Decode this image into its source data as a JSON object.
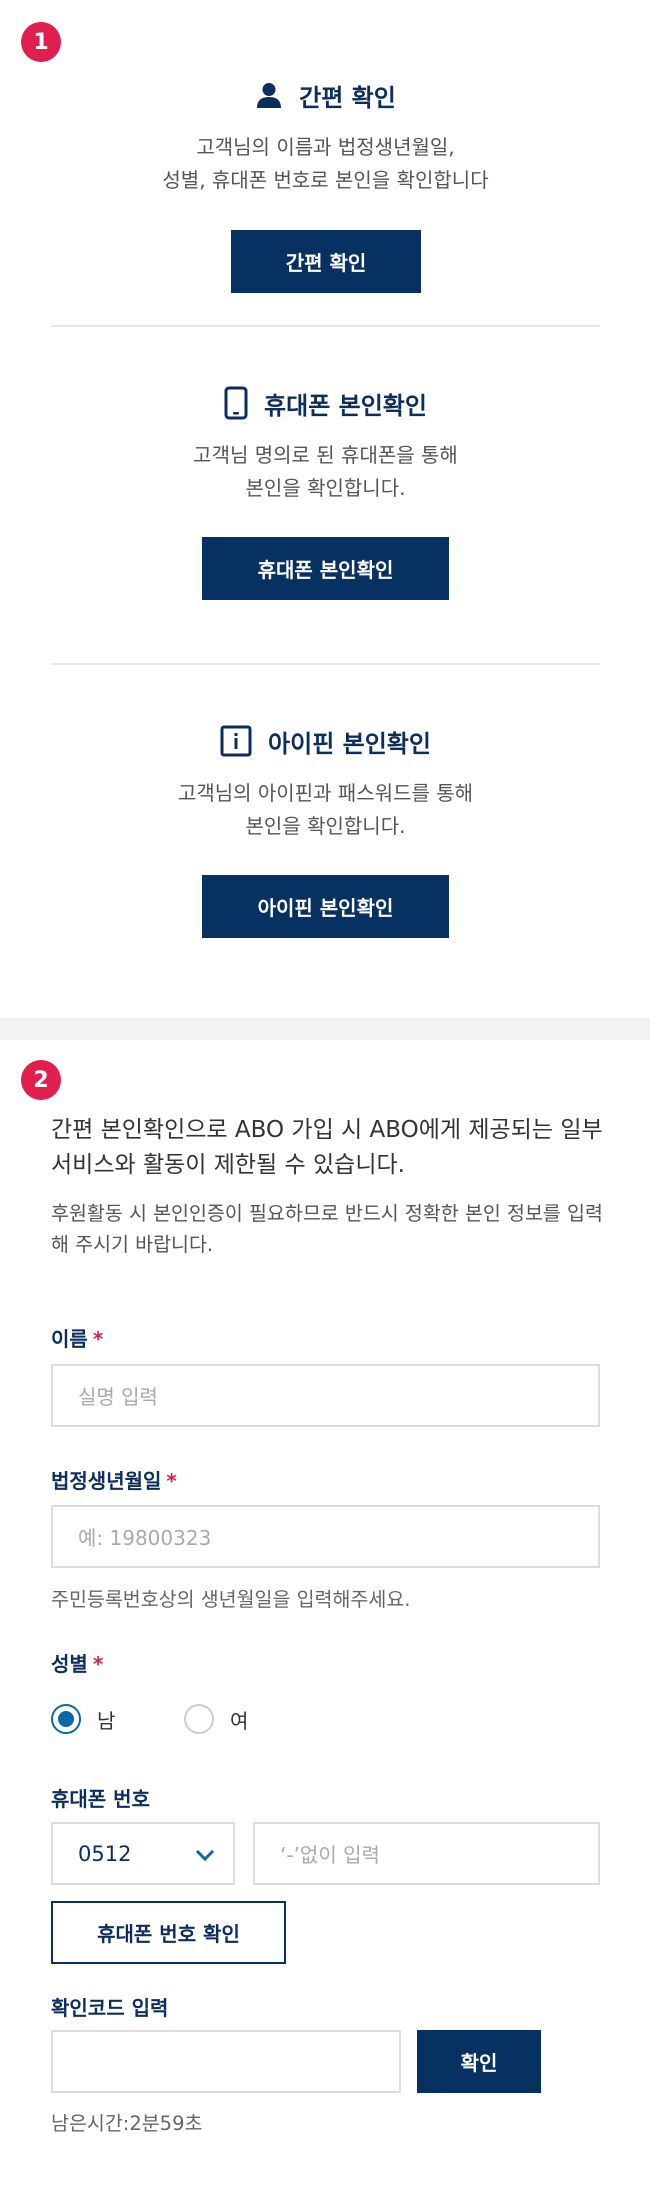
{
  "steps": {
    "one": "1",
    "two": "2"
  },
  "methods": [
    {
      "icon": "person-icon",
      "title": "간편 확인",
      "description": "고객님의 이름과 법정생년월일,\n성별, 휴대폰 번호로 본인을 확인합니다",
      "button": "간편 확인"
    },
    {
      "icon": "smartphone-icon",
      "title": "휴대폰 본인확인",
      "description": "고객님 명의로 된 휴대폰을 통해\n본인을 확인합니다.",
      "button": "휴대폰 본인확인"
    },
    {
      "icon": "info-icon",
      "title": "아이핀 본인확인",
      "description": "고객님의 아이핀과 패스워드를 통해\n본인을 확인합니다.",
      "button": "아이핀 본인확인"
    }
  ],
  "notice": {
    "title": "간편 본인확인으로 ABO 가입 시 ABO에게 제공되는 일부 서비스와 활동이 제한될 수 있습니다.",
    "description": "후원활동 시 본인인증이 필요하므로 반드시 정확한 본인 정보를 입력해 주시기 바랍니다."
  },
  "form": {
    "required_mark": "*",
    "name": {
      "label": "이름",
      "placeholder": "실명 입력"
    },
    "birth": {
      "label": "법정생년월일",
      "placeholder": "예: 19800323",
      "hint": "주민등록번호상의 생년월일을 입력해주세요."
    },
    "gender": {
      "label": "성별",
      "options": [
        "남",
        "여"
      ],
      "selected": "남"
    },
    "phone": {
      "label": "휴대폰 번호",
      "prefix": "0512",
      "placeholder": "‘-’없이 입력",
      "verify_button": "휴대폰 번호 확인"
    },
    "code": {
      "label": "확인코드 입력",
      "value": "",
      "confirm_button": "확인",
      "timer": "남은시간:2분59초"
    }
  },
  "colors": {
    "navy": "#073161",
    "accent_red": "#e01e4f",
    "radio_blue": "#0a67a8"
  }
}
